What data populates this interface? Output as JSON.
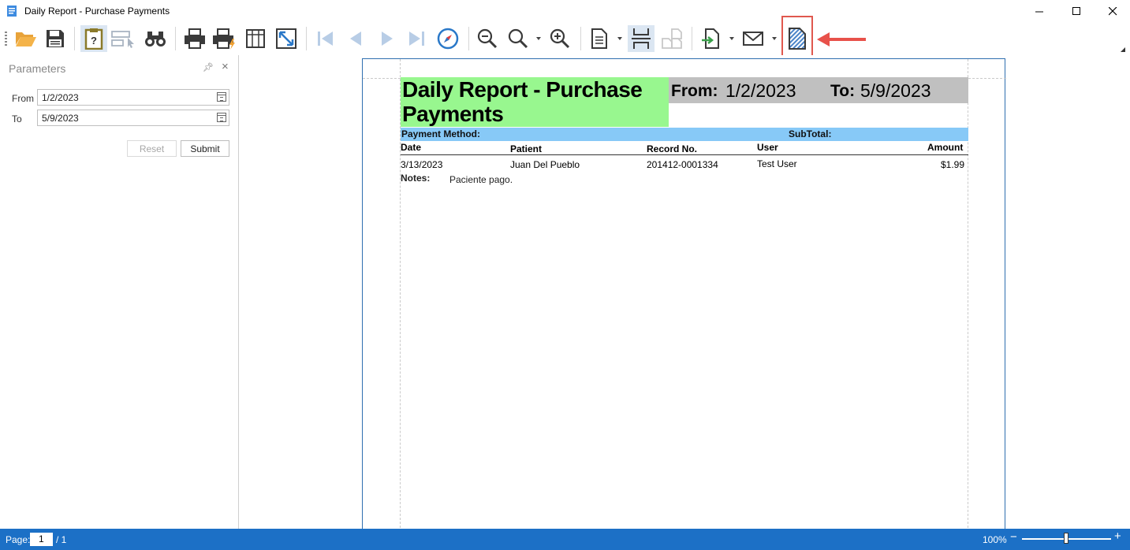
{
  "window": {
    "title": "Daily Report - Purchase Payments"
  },
  "parameters": {
    "title": "Parameters",
    "from_label": "From",
    "from_value": "1/2/2023",
    "to_label": "To",
    "to_value": "5/9/2023",
    "reset_label": "Reset",
    "submit_label": "Submit"
  },
  "report": {
    "title": "Daily Report - Purchase Payments",
    "from_label": "From:",
    "from_value": "1/2/2023",
    "to_label": "To:",
    "to_value": "5/9/2023",
    "group_label": "Payment Method:",
    "subtotal_label": "SubTotal:",
    "columns": {
      "date": "Date",
      "patient": "Patient",
      "record": "Record No.",
      "user": "User",
      "amount": "Amount"
    },
    "rows": [
      {
        "date": "3/13/2023",
        "patient": "Juan Del Pueblo",
        "record": "201412-0001334",
        "user": "Test User",
        "amount": "$1.99",
        "notes_label": "Notes:",
        "notes": "Paciente pago."
      }
    ],
    "colors": {
      "title_bg": "#98f78f",
      "range_bg": "#c0c0c0",
      "group_bg": "#87c9f7"
    }
  },
  "statusbar": {
    "page_label": "Page:",
    "page_value": "1",
    "page_total": "/ 1",
    "zoom": "100%",
    "zoom_level_percent": 100
  },
  "toolbar_icons": [
    "open-icon",
    "save-icon",
    "parameters-icon",
    "select-icon",
    "find-icon",
    "print-icon",
    "quick-print-icon",
    "page-setup-icon",
    "fit-page-icon",
    "first-page-icon",
    "previous-page-icon",
    "next-page-icon",
    "last-page-icon",
    "navigate-icon",
    "zoom-out-icon",
    "zoom-icon",
    "zoom-in-icon",
    "view-icon",
    "continuous-icon",
    "multi-page-icon",
    "export-icon",
    "email-icon",
    "watermark-icon"
  ]
}
